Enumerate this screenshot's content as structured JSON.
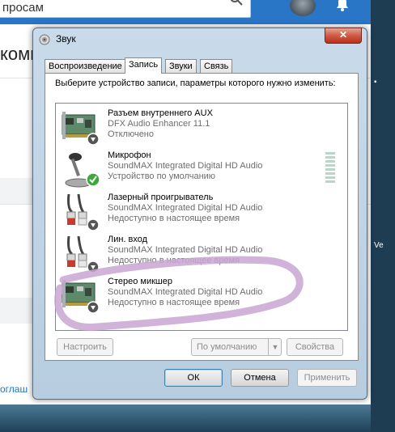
{
  "background": {
    "search_text": "просам",
    "heading": "комп",
    "footer_link": "оглаш",
    "right_edge_text": "Ve"
  },
  "dialog": {
    "title": "Звук",
    "close_label": "✕",
    "tabs": [
      {
        "label": "Воспроизведение",
        "active": false
      },
      {
        "label": "Запись",
        "active": true
      },
      {
        "label": "Звуки",
        "active": false
      },
      {
        "label": "Связь",
        "active": false
      }
    ],
    "instruction": "Выберите устройство записи, параметры которого нужно изменить:",
    "devices": [
      {
        "name": "Разъем внутреннего  AUX",
        "driver": "DFX Audio Enhancer 11.1",
        "status": "Отключено",
        "icon": "sound-card-icon",
        "badge": "down-arrow"
      },
      {
        "name": "Микрофон",
        "driver": "SoundMAX Integrated Digital HD Audio",
        "status": "Устройство по умолчанию",
        "icon": "microphone-icon",
        "badge": "green-check"
      },
      {
        "name": "Лазерный проигрыватель",
        "driver": "SoundMAX Integrated Digital HD Audio",
        "status": "Недоступно в настоящее время",
        "icon": "rca-cable-icon",
        "badge": "down-arrow"
      },
      {
        "name": "Лин. вход",
        "driver": "SoundMAX Integrated Digital HD Audio",
        "status": "Недоступно в настоящее время",
        "icon": "rca-cable-icon",
        "badge": "down-arrow"
      },
      {
        "name": "Стерео микшер",
        "driver": "SoundMAX Integrated Digital HD Audio",
        "status": "Недоступно в настоящее время",
        "icon": "sound-card-icon",
        "badge": "down-arrow"
      }
    ],
    "buttons": {
      "configure": "Настроить",
      "set_default": "По умолчанию",
      "properties": "Свойства",
      "ok": "ОК",
      "cancel": "Отмена",
      "apply": "Применить"
    },
    "annotation_color": "#c9a6d4"
  }
}
